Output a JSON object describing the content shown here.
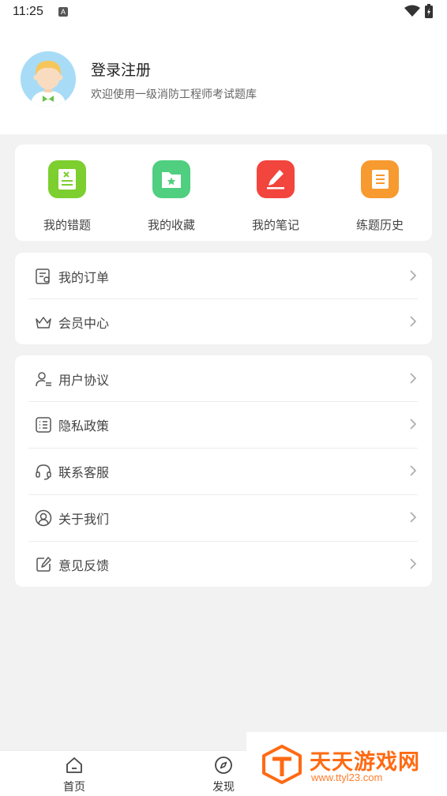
{
  "status_bar": {
    "time": "11:25",
    "notification_letter": "A"
  },
  "profile": {
    "title": "登录注册",
    "subtitle": "欢迎使用一级消防工程师考试题库"
  },
  "shortcuts": [
    {
      "label": "我的错题",
      "icon": "wrong-questions-icon",
      "color": "#7ccf2e"
    },
    {
      "label": "我的收藏",
      "icon": "favorites-folder-icon",
      "color": "#4fcf7f"
    },
    {
      "label": "我的笔记",
      "icon": "notes-pen-icon",
      "color": "#f2453d"
    },
    {
      "label": "练题历史",
      "icon": "history-scroll-icon",
      "color": "#f79a2f"
    }
  ],
  "orders_menu": [
    {
      "label": "我的订单",
      "icon": "order-list-icon"
    },
    {
      "label": "会员中心",
      "icon": "crown-icon"
    }
  ],
  "settings_menu": [
    {
      "label": "用户协议",
      "icon": "user-agreement-icon"
    },
    {
      "label": "隐私政策",
      "icon": "privacy-list-icon"
    },
    {
      "label": "联系客服",
      "icon": "headset-icon"
    },
    {
      "label": "关于我们",
      "icon": "user-circle-icon"
    },
    {
      "label": "意见反馈",
      "icon": "feedback-edit-icon"
    }
  ],
  "tabbar": [
    {
      "label": "首页",
      "icon": "home-icon"
    },
    {
      "label": "发现",
      "icon": "compass-icon"
    }
  ],
  "watermark": {
    "title": "天天游戏网",
    "url": "www.ttyl23.com"
  }
}
